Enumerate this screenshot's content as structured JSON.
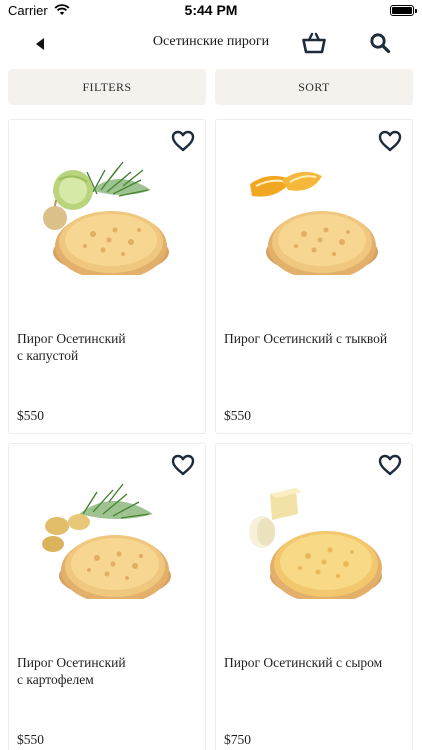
{
  "status_bar": {
    "carrier": "Carrier",
    "time": "5:44 PM"
  },
  "nav": {
    "title": "Осетинские пироги"
  },
  "controls": {
    "filters_label": "FILTERS",
    "sort_label": "SORT"
  },
  "products": [
    {
      "name_line1": "Пирог Осетинский",
      "name_line2": "с капустой",
      "price": "$550"
    },
    {
      "name_line1": "Пирог Осетинский с тыквой",
      "name_line2": "",
      "price": "$550"
    },
    {
      "name_line1": "Пирог Осетинский",
      "name_line2": "с картофелем",
      "price": "$550"
    },
    {
      "name_line1": "Пирог Осетинский с сыром",
      "name_line2": "",
      "price": "$750"
    }
  ],
  "colors": {
    "accent_dark": "#1d2b3a",
    "pill_bg": "#f5f2ee",
    "card_border": "#f0ede9"
  }
}
